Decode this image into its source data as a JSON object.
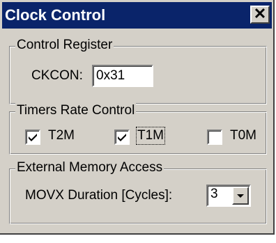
{
  "window": {
    "title": "Clock Control",
    "close_symbol": "✕"
  },
  "control_register": {
    "legend": "Control Register",
    "ckcon_label": "CKCON:",
    "ckcon_value": "0x31"
  },
  "timers": {
    "legend": "Timers Rate Control",
    "items": [
      {
        "label": "T2M",
        "checked": true
      },
      {
        "label": "T1M",
        "checked": true
      },
      {
        "label": "T0M",
        "checked": false
      }
    ]
  },
  "external_memory": {
    "legend": "External Memory Access",
    "movx_label": "MOVX Duration [Cycles]:",
    "movx_value": "3"
  }
}
